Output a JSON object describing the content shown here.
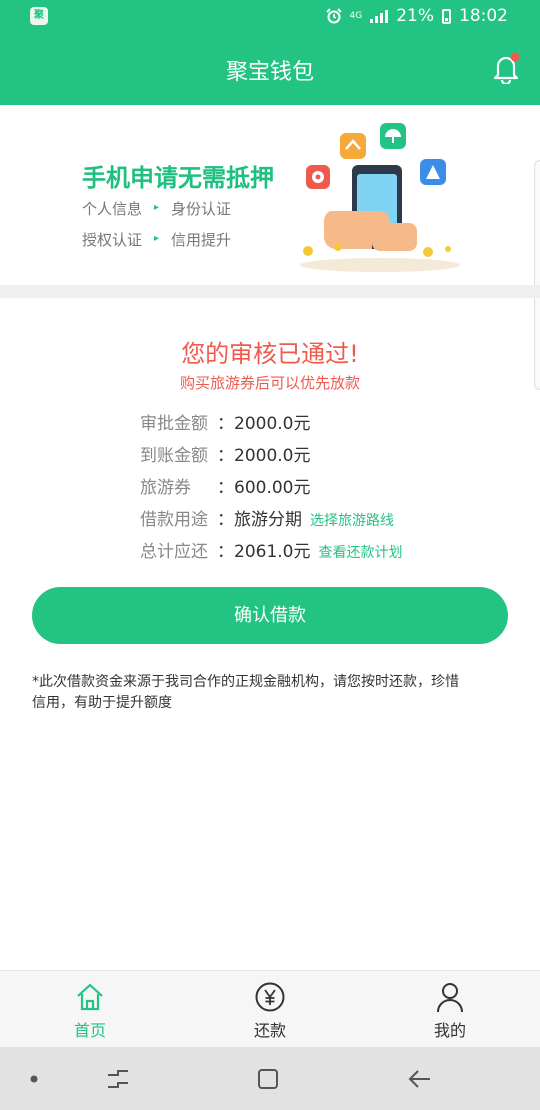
{
  "status_bar": {
    "network": "4G",
    "battery": "21%",
    "time": "18:02",
    "app_icon_text": "聚"
  },
  "header": {
    "title": "聚宝钱包",
    "notification_dot_color": "#f05a4e"
  },
  "banner": {
    "headline": "手机申请无需抵押",
    "steps_row1": [
      "个人信息",
      "身份认证"
    ],
    "steps_row2": [
      "授权认证",
      "信用提升"
    ]
  },
  "approval": {
    "title": "您的审核已通过!",
    "subtitle": "购买旅游券后可以优先放款",
    "rows": [
      {
        "label": "审批金额",
        "value": "2000.0元",
        "link": ""
      },
      {
        "label": "到账金额",
        "value": "2000.0元",
        "link": ""
      },
      {
        "label": "旅游券",
        "value": "600.00元",
        "link": ""
      },
      {
        "label": "借款用途",
        "value": "旅游分期",
        "link": "选择旅游路线"
      },
      {
        "label": "总计应还",
        "value": "2061.0元",
        "link": "查看还款计划"
      }
    ],
    "colon": "："
  },
  "confirm_button": "确认借款",
  "note": "*此次借款资金来源于我司合作的正规金融机构，请您按时还款，珍惜信用，有助于提升额度",
  "tabs": [
    {
      "label": "首页",
      "icon": "home-icon",
      "active": true
    },
    {
      "label": "还款",
      "icon": "yuan-icon",
      "active": false
    },
    {
      "label": "我的",
      "icon": "user-icon",
      "active": false
    }
  ],
  "colors": {
    "brand": "#23c384",
    "alert": "#f05a4e"
  }
}
